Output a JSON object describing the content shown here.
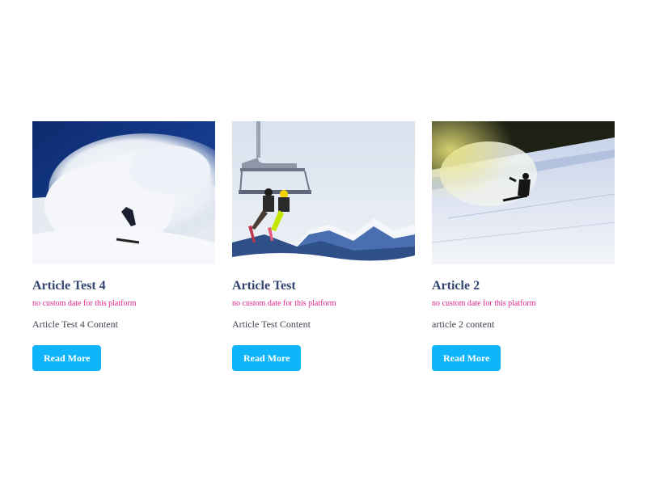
{
  "articles": [
    {
      "image": "snowboarder-powder-spray-photo",
      "title": "Article Test 4",
      "date": "no custom date for this platform",
      "content": "Article Test 4 Content",
      "button": "Read More"
    },
    {
      "image": "ski-chairlift-mountains-photo",
      "title": "Article Test",
      "date": "no custom date for this platform",
      "content": "Article Test Content",
      "button": "Read More"
    },
    {
      "image": "snowboarder-slope-photo",
      "title": "Article 2",
      "date": "no custom date for this platform",
      "content": "article 2 content",
      "button": "Read More"
    }
  ],
  "colors": {
    "title": "#34456f",
    "date": "#e0248a",
    "button": "#10b4fb"
  }
}
